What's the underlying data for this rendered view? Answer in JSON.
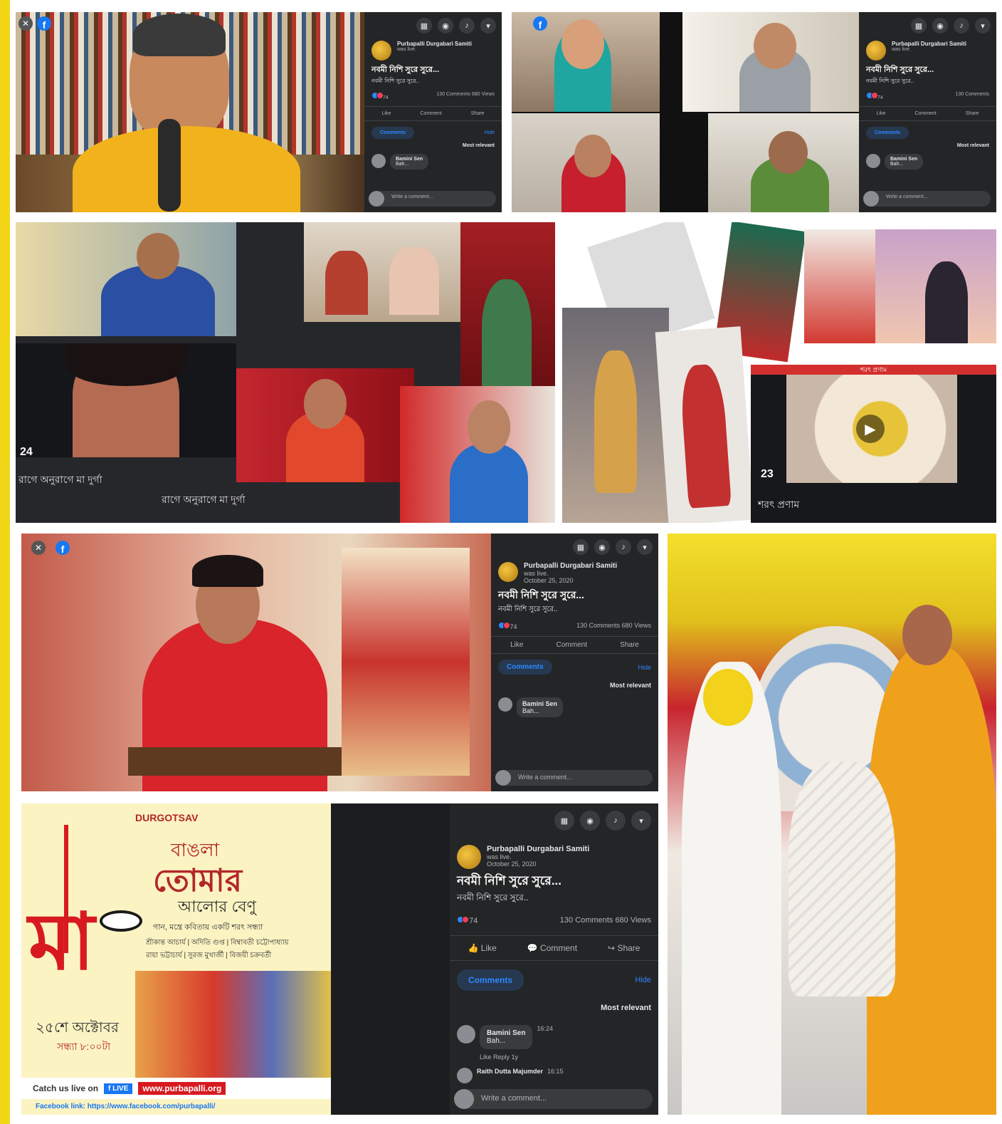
{
  "fb_post": {
    "page_name": "Purbapalli Durgabari Samiti",
    "status": "was live.",
    "date": "October 25, 2020",
    "title": "নবমী নিশি সুরে সুরে...",
    "description": "নবমী নিশি সুরে সুরে..",
    "reaction_count": "74",
    "comments_count": "130 Comments",
    "views": "680 Views",
    "actions": [
      "Like",
      "Comment",
      "Share"
    ],
    "tab_comments": "Comments",
    "hide": "Hide",
    "sort": "Most relevant",
    "comment1_author": "Bamini Sen",
    "comment1_text": "Bah...",
    "comment1_time": "16:24",
    "comment1_meta": "Like  Reply  1y",
    "comment2_author": "Raith Dutta Majumder",
    "comment2_time": "16:15",
    "write_placeholder": "Write a comment..."
  },
  "collage": {
    "video_number_a": "24",
    "caption_a": "রাগে অনুরাগে মা দুর্গা",
    "video_number_b": "23",
    "caption_b": "শরৎ প্রণাম",
    "banner_b": "শরৎ প্রণাম"
  },
  "poster": {
    "brand": "DURGOTSAV",
    "line1": "বাঙলা",
    "line2": "তোমার",
    "line3": "আলোর বেণু",
    "subtitle": "গান, মন্ত্রে কবিতায় একটি শরৎ সন্ধ্যা",
    "artists1": "শ্রীকান্ত আচার্য | অদিতি গুপ্ত | বিম্বাবতী চট্টোপাধ্যায়",
    "artists2": "রায়া ভট্টাচার্য | সুরজ মুখার্জী | বিজয়ী চক্রবর্তী",
    "big_char": "মা",
    "date": "২৫শে অক্টোবর",
    "time": "সন্ধ্যা ৮:০০টা",
    "catch": "Catch us live on",
    "live": "LIVE",
    "url": "www.purbapalli.org",
    "fb_link": "Facebook link: https://www.facebook.com/purbapalli/"
  },
  "colors": {
    "accent": "#1877f2",
    "fb_bg": "#242526",
    "yellow_bar": "#f2d516",
    "poster_red": "#d71920"
  }
}
